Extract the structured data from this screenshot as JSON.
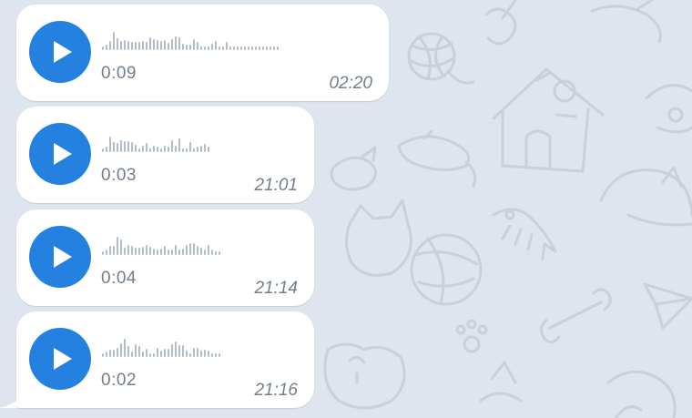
{
  "messages": [
    {
      "duration": "0:09",
      "time": "02:20",
      "waveform": [
        0.2,
        0.25,
        0.45,
        0.9,
        0.6,
        0.45,
        0.5,
        0.45,
        0.4,
        0.4,
        0.4,
        0.45,
        0.4,
        0.65,
        0.55,
        0.5,
        0.45,
        0.5,
        0.35,
        0.55,
        0.7,
        0.65,
        0.3,
        0.25,
        0.25,
        0.55,
        0.4,
        0.2,
        0.2,
        0.2,
        0.3,
        0.45,
        0.2,
        0.2,
        0.4,
        0.2,
        0.2,
        0.2,
        0.2,
        0.2,
        0.2,
        0.2,
        0.2,
        0.2,
        0.2,
        0.2,
        0.2,
        0.2,
        0.2
      ]
    },
    {
      "duration": "0:03",
      "time": "21:01",
      "waveform": [
        0.2,
        0.25,
        0.75,
        0.5,
        0.45,
        0.6,
        0.55,
        0.55,
        0.5,
        0.35,
        0.2,
        0.3,
        0.45,
        0.2,
        0.3,
        0.25,
        0.2,
        0.3,
        0.25,
        0.6,
        0.3,
        0.7,
        0.2,
        0.2,
        0.5,
        0.2,
        0.25,
        0.3,
        0.4,
        0.25
      ]
    },
    {
      "duration": "0:04",
      "time": "21:14",
      "waveform": [
        0.2,
        0.25,
        0.45,
        0.45,
        0.9,
        0.75,
        0.35,
        0.5,
        0.45,
        0.35,
        0.35,
        0.4,
        0.5,
        0.4,
        0.3,
        0.25,
        0.3,
        0.45,
        0.25,
        0.25,
        0.5,
        0.25,
        0.3,
        0.5,
        0.6,
        0.6,
        0.45,
        0.35,
        0.25,
        0.5,
        0.25,
        0.2,
        0.2
      ]
    },
    {
      "duration": "0:02",
      "time": "21:16",
      "waveform": [
        0.2,
        0.25,
        0.35,
        0.35,
        0.45,
        0.7,
        0.9,
        0.55,
        0.25,
        0.65,
        0.55,
        0.25,
        0.4,
        0.2,
        0.2,
        0.45,
        0.3,
        0.4,
        0.4,
        0.65,
        0.75,
        0.6,
        0.6,
        0.3,
        0.2,
        0.45,
        0.45,
        0.3,
        0.35,
        0.3,
        0.2,
        0.2,
        0.2
      ]
    }
  ],
  "colors": {
    "play": "#2481e0",
    "waveform": "#b3bdc8",
    "meta": "#727e8a",
    "background": "#dfe5ee"
  },
  "icons": {
    "play": "play-icon",
    "pattern": [
      "yarn-ball-icon",
      "doghouse-icon",
      "mouse-icon",
      "bird-icon",
      "cat-icon",
      "fish-skeleton-icon",
      "bone-icon",
      "paw-icon",
      "paper-plane-icon"
    ]
  }
}
